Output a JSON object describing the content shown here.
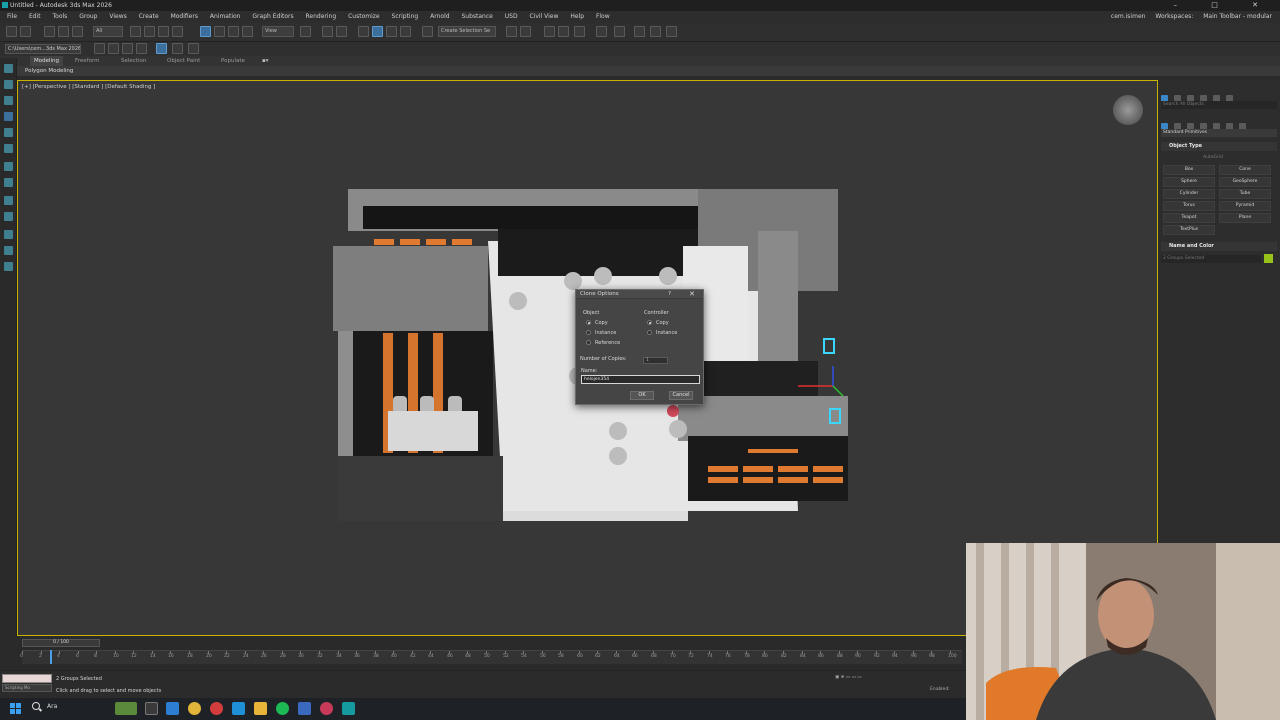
{
  "window": {
    "title": "Untitled - Autodesk 3ds Max 2026",
    "controls": [
      "–",
      "□",
      "✕"
    ]
  },
  "menu": {
    "items": [
      "File",
      "Edit",
      "Tools",
      "Group",
      "Views",
      "Create",
      "Modifiers",
      "Animation",
      "Graph Editors",
      "Rendering",
      "Customize",
      "Scripting",
      "Arnold",
      "Substance",
      "USD",
      "Civil View",
      "Help",
      "Flow"
    ],
    "user": "cem.isimen",
    "workspaces_label": "Workspaces:",
    "workspace_value": "Main Toolbar - modular"
  },
  "toolbar": {
    "filter_value": "All",
    "view_value": "View",
    "selection_set_placeholder": "Create Selection Se",
    "path_value": "C:\\Users\\cem...3ds Max 2026"
  },
  "ribbon": {
    "tabs": [
      "Modeling",
      "Freeform",
      "Selection",
      "Object Paint",
      "Populate"
    ],
    "active_tab": "Modeling",
    "sub_label": "Polygon Modeling"
  },
  "viewport": {
    "label": "[+] [Perspective ] [Standard ] [Default Shading ]"
  },
  "clone_dialog": {
    "title": "Clone Options",
    "help": "?",
    "close": "✕",
    "object_group": "Object",
    "object_options": [
      "Copy",
      "Instance",
      "Reference"
    ],
    "object_selected": "Copy",
    "controller_group": "Controller",
    "controller_options": [
      "Copy",
      "Instance"
    ],
    "controller_selected": "Copy",
    "copies_label": "Number of Copies:",
    "copies_value": "1",
    "name_label": "Name:",
    "name_value": "helojen354",
    "ok_label": "OK",
    "cancel_label": "Cancel"
  },
  "command_panel": {
    "search_placeholder": "Search All Objects",
    "category": "Standard Primitives",
    "object_type_title": "Object Type",
    "autogrid_label": "AutoGrid",
    "primitives": [
      "Box",
      "Cone",
      "Sphere",
      "GeoSphere",
      "Cylinder",
      "Tube",
      "Torus",
      "Pyramid",
      "Teapot",
      "Plane",
      "TextPlus"
    ],
    "name_color_title": "Name and Color",
    "name_value": "2 Groups Selected",
    "swatch_color": "#96c21a"
  },
  "timeline": {
    "frame_display": "0 / 100",
    "ticks": [
      "0",
      "2",
      "4",
      "6",
      "8",
      "10",
      "12",
      "14",
      "16",
      "18",
      "20",
      "22",
      "24",
      "26",
      "28",
      "30",
      "32",
      "34",
      "36",
      "38",
      "40",
      "42",
      "44",
      "46",
      "48",
      "50",
      "52",
      "54",
      "56",
      "58",
      "60",
      "62",
      "64",
      "66",
      "68",
      "70",
      "72",
      "74",
      "76",
      "78",
      "80",
      "82",
      "84",
      "86",
      "88",
      "90",
      "92",
      "94",
      "96",
      "98",
      "100"
    ]
  },
  "status": {
    "maxscript_label": "Scripting Mo",
    "selection": "2 Groups Selected",
    "prompt": "Click and drag to select and move objects",
    "enabled": "Enabled:"
  },
  "taskbar": {
    "search_label": "Ara"
  }
}
